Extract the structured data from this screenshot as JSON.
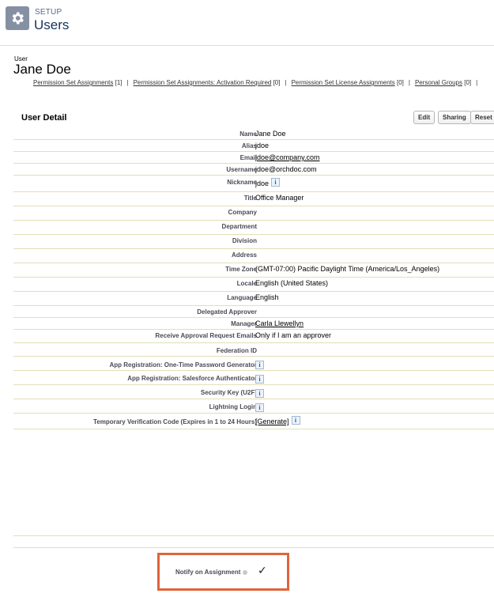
{
  "header": {
    "section": "SETUP",
    "title": "Users"
  },
  "user": {
    "label": "User",
    "name": "Jane Doe"
  },
  "related_links": [
    {
      "text": "Permission Set Assignments",
      "count": "[1]"
    },
    {
      "text": "Permission Set Assignments: Activation Required",
      "count": "[0]"
    },
    {
      "text": "Permission Set License Assignments",
      "count": "[0]"
    },
    {
      "text": "Personal Groups",
      "count": "[0]"
    }
  ],
  "detail": {
    "title": "User Detail",
    "buttons": {
      "edit": "Edit",
      "sharing": "Sharing",
      "reset": "Reset P"
    },
    "rows": [
      {
        "label": "Name",
        "value": "Jane Doe"
      },
      {
        "label": "Alias",
        "value": "jdoe"
      },
      {
        "label": "Email",
        "value": "jdoe@company.com"
      },
      {
        "label": "Username",
        "value": "jdoe@orchdoc.com"
      },
      {
        "label": "Nickname",
        "value": "jdoe"
      },
      {
        "label": "Title",
        "value": "Office Manager"
      },
      {
        "label": "Company",
        "value": ""
      },
      {
        "label": "Department",
        "value": ""
      },
      {
        "label": "Division",
        "value": ""
      },
      {
        "label": "Address",
        "value": ""
      },
      {
        "label": "Time Zone",
        "value": "(GMT-07:00) Pacific Daylight Time (America/Los_Angeles)"
      },
      {
        "label": "Locale",
        "value": "English (United States)"
      },
      {
        "label": "Language",
        "value": "English"
      },
      {
        "label": "Delegated Approver",
        "value": ""
      },
      {
        "label": "Manager",
        "value": "Carla Llewellyn"
      },
      {
        "label": "Receive Approval Request Emails",
        "value": "Only if I am an approver"
      },
      {
        "label": "Federation ID",
        "value": ""
      },
      {
        "label": "App Registration: One-Time Password Generator",
        "value": ""
      },
      {
        "label": "App Registration: Salesforce Authenticator",
        "value": ""
      },
      {
        "label": "Security Key (U2F)",
        "value": ""
      },
      {
        "label": "Lightning Login",
        "value": ""
      },
      {
        "label": "Temporary Verification Code (Expires in 1 to 24 Hours)",
        "value": "[Generate]"
      }
    ]
  },
  "notify": {
    "label": "Notify on Assignment",
    "checked": true
  }
}
